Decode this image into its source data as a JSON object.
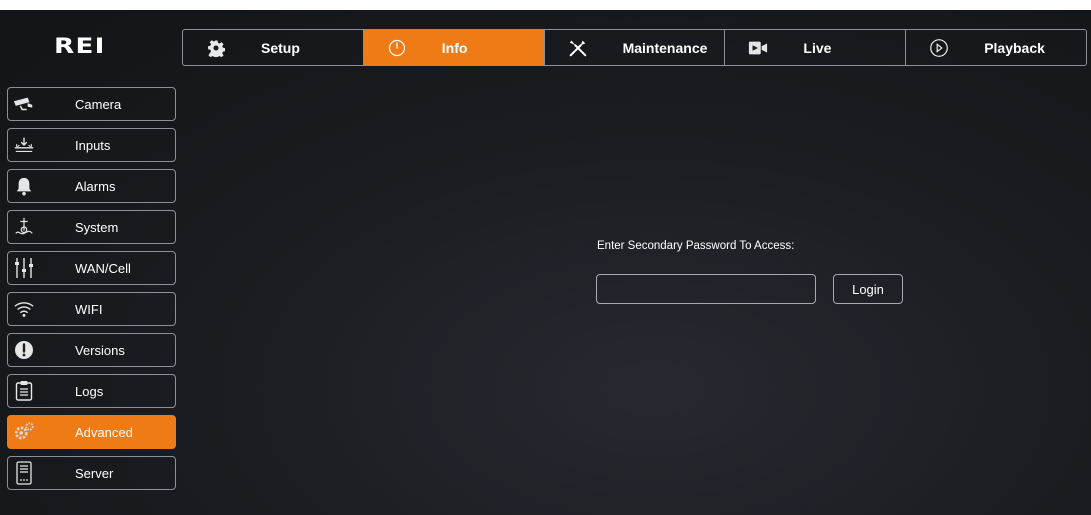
{
  "brand": {
    "logo_text": "REI"
  },
  "topnav": {
    "tabs": [
      {
        "label": "Setup",
        "icon": "gear-icon"
      },
      {
        "label": "Info",
        "icon": "clock-icon",
        "active": true
      },
      {
        "label": "Maintenance",
        "icon": "tools-icon"
      },
      {
        "label": "Live",
        "icon": "video-camera-icon"
      },
      {
        "label": "Playback",
        "icon": "play-circle-icon"
      }
    ]
  },
  "sidebar": {
    "items": [
      {
        "label": "Camera",
        "icon": "security-camera-icon"
      },
      {
        "label": "Inputs",
        "icon": "inputs-icon"
      },
      {
        "label": "Alarms",
        "icon": "bell-icon"
      },
      {
        "label": "System",
        "icon": "system-icon"
      },
      {
        "label": "WAN/Cell",
        "icon": "sliders-icon"
      },
      {
        "label": "WIFI",
        "icon": "wifi-icon"
      },
      {
        "label": "Versions",
        "icon": "alert-circle-icon"
      },
      {
        "label": "Logs",
        "icon": "clipboard-icon"
      },
      {
        "label": "Advanced",
        "icon": "gears-icon",
        "active": true
      },
      {
        "label": "Server",
        "icon": "server-icon"
      }
    ]
  },
  "main": {
    "prompt": "Enter Secondary Password To Access:",
    "password_value": "",
    "login_label": "Login"
  },
  "colors": {
    "accent": "#ef7b16",
    "background": "#16191c",
    "border": "#8d9096",
    "text": "#ffffff"
  }
}
